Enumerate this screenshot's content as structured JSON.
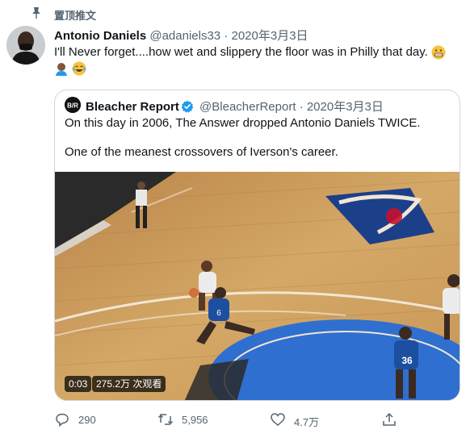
{
  "pinned": {
    "label": "置顶推文",
    "icon": "pin-icon"
  },
  "tweet": {
    "author_name": "Antonio Daniels",
    "author_handle": "@adaniels33",
    "separator": "·",
    "date": "2020年3月3日",
    "text": "I'll Never forget....how wet and slippery the floor was in Philly that day.",
    "emojis": [
      "grimacing-face-emoji",
      "man-facepalming-emoji",
      "tears-of-joy-emoji"
    ]
  },
  "quoted": {
    "author_name": "Bleacher Report",
    "author_handle": "@BleacherReport",
    "separator": "·",
    "date": "2020年3月3日",
    "line1": "On this day in 2006, The Answer dropped Antonio Daniels TWICE.",
    "line2": "One of the meanest crossovers of Iverson's career.",
    "avatar_text": "B/R",
    "video": {
      "duration": "0:03",
      "views": "275.2万 次观看"
    }
  },
  "actions": {
    "reply_count": "290",
    "retweet_count": "5,956",
    "like_count": "4.7万"
  },
  "colors": {
    "muted": "#536471",
    "accent": "#1d9bf0",
    "border": "#cfd9de",
    "court": "#c89a5e"
  }
}
